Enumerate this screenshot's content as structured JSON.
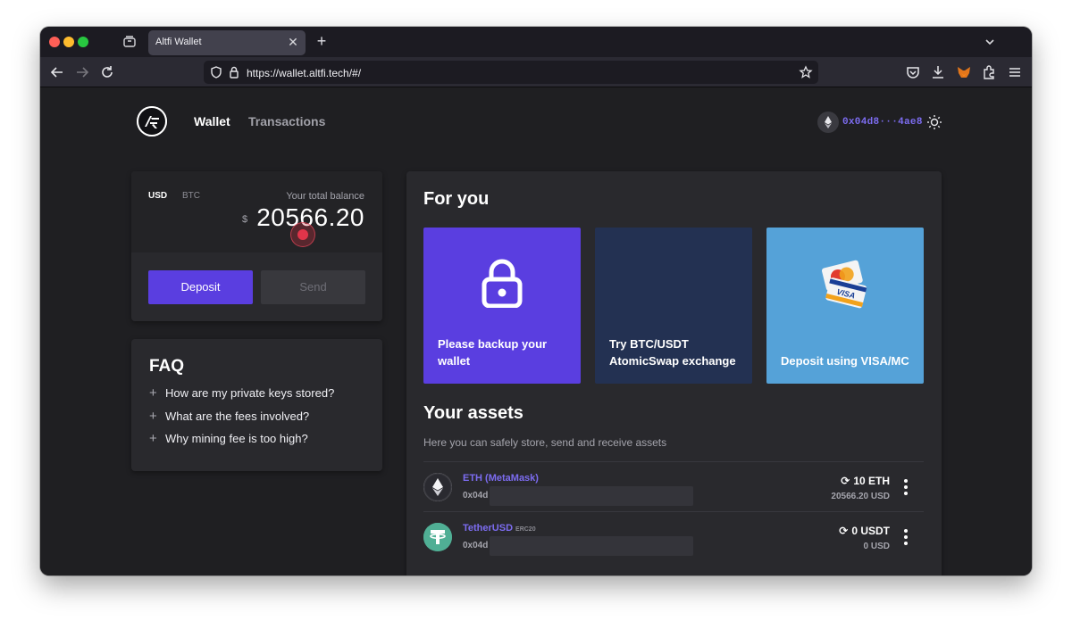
{
  "browser": {
    "tab_title": "Altfi Wallet",
    "url": "https://wallet.altfi.tech/#/"
  },
  "header": {
    "nav": [
      "Wallet",
      "Transactions"
    ],
    "address": "0x04d8···4ae8"
  },
  "balance": {
    "currencies": [
      "USD",
      "BTC"
    ],
    "label": "Your total balance",
    "symbol": "$",
    "value": "20566.20",
    "deposit_label": "Deposit",
    "send_label": "Send"
  },
  "faq": {
    "title": "FAQ",
    "items": [
      "How are my private keys stored?",
      "What are the fees involved?",
      "Why mining fee is too high?"
    ]
  },
  "for_you": {
    "title": "For you",
    "cards": [
      "Please backup your wallet",
      "Try BTC/USDT AtomicSwap exchange",
      "Deposit using VISA/MC"
    ]
  },
  "assets": {
    "title": "Your assets",
    "subtitle": "Here you can safely store, send and receive assets",
    "rows": [
      {
        "name": "ETH (MetaMask)",
        "tag": "",
        "address": "0x04d",
        "balance": "10 ETH",
        "usd": "20566.20 USD"
      },
      {
        "name": "TetherUSD",
        "tag": "ERC20",
        "address": "0x04d",
        "balance": "0 USDT",
        "usd": "0 USD"
      }
    ]
  },
  "colors": {
    "accent": "#5a3ee0",
    "link": "#7c6cf0",
    "background": "#1f1f22",
    "card": "#29292d"
  }
}
